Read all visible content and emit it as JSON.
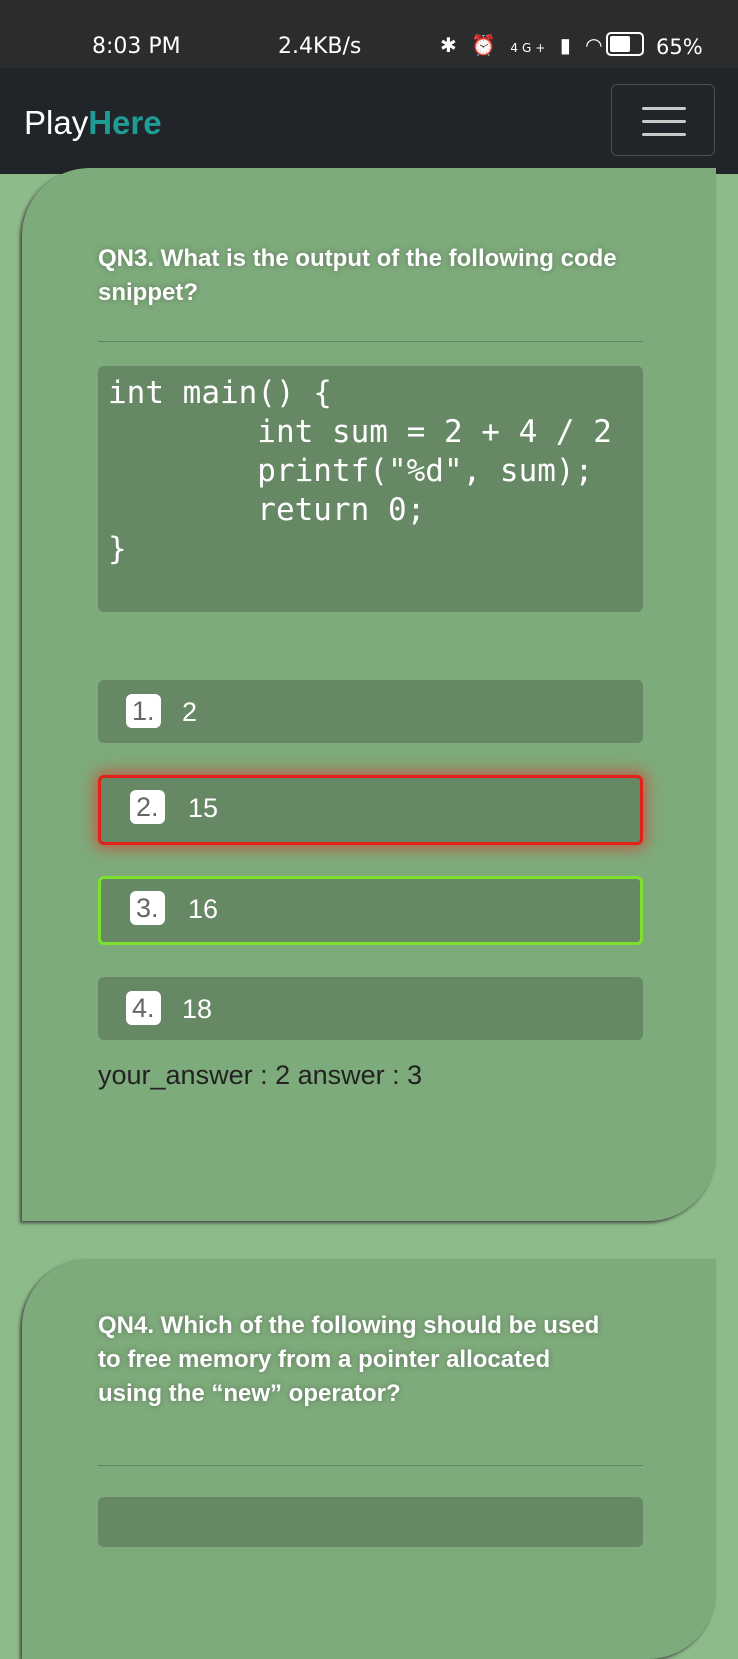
{
  "status_bar": {
    "time": "8:03 PM",
    "speed": "2.4KB/s",
    "network": "4G+",
    "battery": "65%"
  },
  "navbar": {
    "brand_prefix": "Play",
    "brand_highlight": "Here",
    "brand_highlight_color": "#1e9c95"
  },
  "question3": {
    "title": "QN3. What is the output of the following code snippet?",
    "code_lines": [
      "int main() {",
      "        int sum = 2 + 4 / 2",
      "        printf(\"%d\", sum);",
      "        return 0;",
      "}"
    ],
    "options": [
      {
        "num": "1.",
        "value": "2",
        "state": "normal"
      },
      {
        "num": "2.",
        "value": "15",
        "state": "wrong"
      },
      {
        "num": "3.",
        "value": "16",
        "state": "correct"
      },
      {
        "num": "4.",
        "value": "18",
        "state": "normal"
      }
    ],
    "result_text": "your_answer : 2 answer : 3"
  },
  "question4": {
    "title": "QN4. Which of the following should be used to free memory from a pointer allocated using the “new” operator?"
  }
}
